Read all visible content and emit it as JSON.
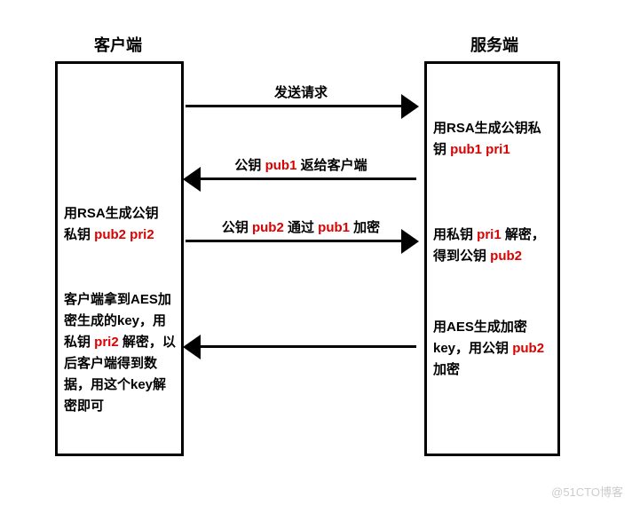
{
  "client": {
    "title": "客户端",
    "text1_a": "用RSA生成公钥",
    "text1_b": "私钥 ",
    "text1_hl": "pub2 pri2",
    "text2_a": "客户端拿到AES加密生成的key，用私钥 ",
    "text2_hl": "pri2",
    "text2_b": " 解密，以后客户端得到数据，用这个key解密即可"
  },
  "server": {
    "title": "服务端",
    "text1_a": "用RSA生成公钥私钥 ",
    "text1_hl": "pub1 pri1",
    "text2_a": "用私钥 ",
    "text2_hl1": "pri1",
    "text2_b": " 解密，得到公钥 ",
    "text2_hl2": "pub2",
    "text3_a": "用AES生成加密key，用公钥 ",
    "text3_hl": "pub2",
    "text3_b": " 加密"
  },
  "arrows": {
    "a1": "发送请求",
    "a2_p": "公钥 ",
    "a2_hl": "pub1",
    "a2_s": " 返给客户端",
    "a3_p": "公钥 ",
    "a3_hl1": "pub2",
    "a3_m": " 通过 ",
    "a3_hl2": "pub1",
    "a3_s": " 加密"
  },
  "watermark": "@51CTO博客"
}
